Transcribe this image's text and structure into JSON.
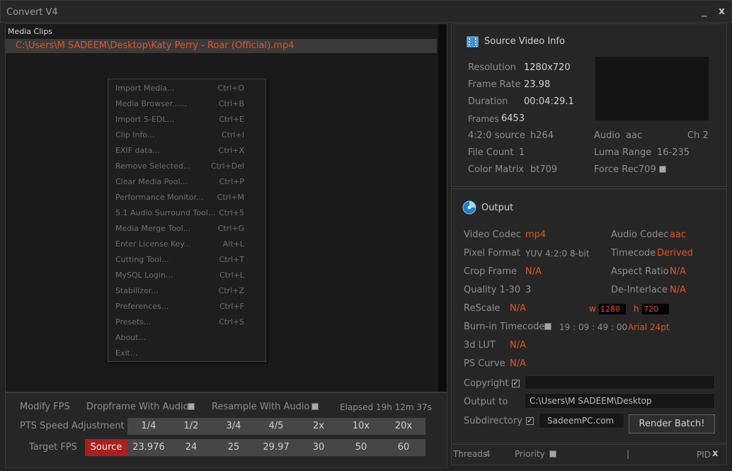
{
  "app": {
    "title": "Convert V4",
    "minimize": "_",
    "close": "x"
  },
  "clips": {
    "title": "Media Clips",
    "items": [
      "C:\\Users\\M SADEEM\\Desktop\\Katy Perry - Roar (Official).mp4"
    ]
  },
  "menu": [
    {
      "label": "Import Media...",
      "shortcut": "Ctrl+O"
    },
    {
      "label": "Media Browser......",
      "shortcut": "Ctrl+B"
    },
    {
      "label": "Import S-EDL...",
      "shortcut": "Ctrl+E"
    },
    {
      "label": "Clip Info...",
      "shortcut": "Ctrl+I"
    },
    {
      "label": "EXIF data...",
      "shortcut": "Ctrl+X"
    },
    {
      "label": "Remove Selected...",
      "shortcut": "Ctrl+Del"
    },
    {
      "label": "Clear Media Pool...",
      "shortcut": "Ctrl+P"
    },
    {
      "label": "Performance Monitor...",
      "shortcut": "Ctrl+M"
    },
    {
      "label": "5.1 Audio Surround Tool...",
      "shortcut": "Ctrl+5"
    },
    {
      "label": "Media Merge Tool...",
      "shortcut": "Ctrl+G"
    },
    {
      "label": "Enter License Key...",
      "shortcut": "Alt+L"
    },
    {
      "label": "Cutting Tool...",
      "shortcut": "Ctrl+T"
    },
    {
      "label": "MySQL Login...",
      "shortcut": "Ctrl+L"
    },
    {
      "label": "Stabilizer...",
      "shortcut": "Ctrl+Z"
    },
    {
      "label": "Preferences...",
      "shortcut": "Ctrl+F"
    },
    {
      "label": "Presets...",
      "shortcut": "Ctrl+S"
    },
    {
      "label": "About...",
      "shortcut": ""
    },
    {
      "label": "Exit...",
      "shortcut": ""
    }
  ],
  "fps": {
    "modify_label": "Modify FPS",
    "dropframe_label": "Dropframe With Audio",
    "resample_label": "Resample With Audio",
    "elapsed": "Elapsed  19h 12m 37s",
    "pts_label": "PTS Speed Adjustment",
    "pts_options": [
      "1/4",
      "1/2",
      "3/4",
      "4/5",
      "2x",
      "10x",
      "20x"
    ],
    "target_label": "Target FPS",
    "target_options": [
      "Source",
      "23.976",
      "24",
      "25",
      "29.97",
      "30",
      "50",
      "60"
    ]
  },
  "source": {
    "title": "Source Video Info",
    "resolution_label": "Resolution",
    "resolution": "1280x720",
    "framerate_label": "Frame Rate",
    "framerate": "23.98",
    "duration_label": "Duration",
    "duration": "00:04:29.1",
    "frames_label": "Frames",
    "frames": "6453",
    "src_label": "4:2:0 source",
    "codec": "h264",
    "audio_label": "Audio",
    "audio": "aac",
    "channels": "Ch 2",
    "filecount_label": "File Count",
    "filecount": "1",
    "luma_label": "Luma Range",
    "luma": "16-235",
    "matrix_label": "Color Matrix",
    "matrix": "bt709",
    "force_label": "Force Rec709"
  },
  "output": {
    "title": "Output",
    "vcodec_label": "Video Codec",
    "vcodec": "mp4",
    "acodec_label": "Audio Codec",
    "acodec": "aac",
    "pixfmt_label": "Pixel Format",
    "pixfmt": "YUV 4:2:0 8-bit",
    "timecode_label": "Timecode",
    "timecode": "Derived",
    "crop_label": "Crop Frame",
    "crop": "N/A",
    "aspect_label": "Aspect Ratio",
    "aspect": "N/A",
    "quality_label": "Quality 1-30",
    "quality": "3",
    "deint_label": "De-Interlace",
    "deint": "N/A",
    "rescale_label": "ReScale",
    "rescale": "N/A",
    "w_label": "w",
    "w": "1280",
    "h_label": "h",
    "h": "720",
    "burnin_label": "Burn-in Timecode",
    "burnin_tc": "19 : 09 : 49 : 00",
    "burnin_font": "Arial 24pt",
    "lut_label": "3d LUT",
    "lut": "N/A",
    "pscurve_label": "PS Curve",
    "pscurve": "N/A",
    "copyright_label": "Copyright",
    "copyright": "",
    "outputto_label": "Output to",
    "outputto": "C:\\Users\\M SADEEM\\Desktop",
    "subdir_label": "Subdirectory",
    "subdir": "SadeemPC.com",
    "render": "Render Batch!"
  },
  "status": {
    "threads_label": "Threads",
    "threads": "4",
    "priority_label": "Priority",
    "sep": "|",
    "pid": "PID",
    "pid_close": "x"
  }
}
